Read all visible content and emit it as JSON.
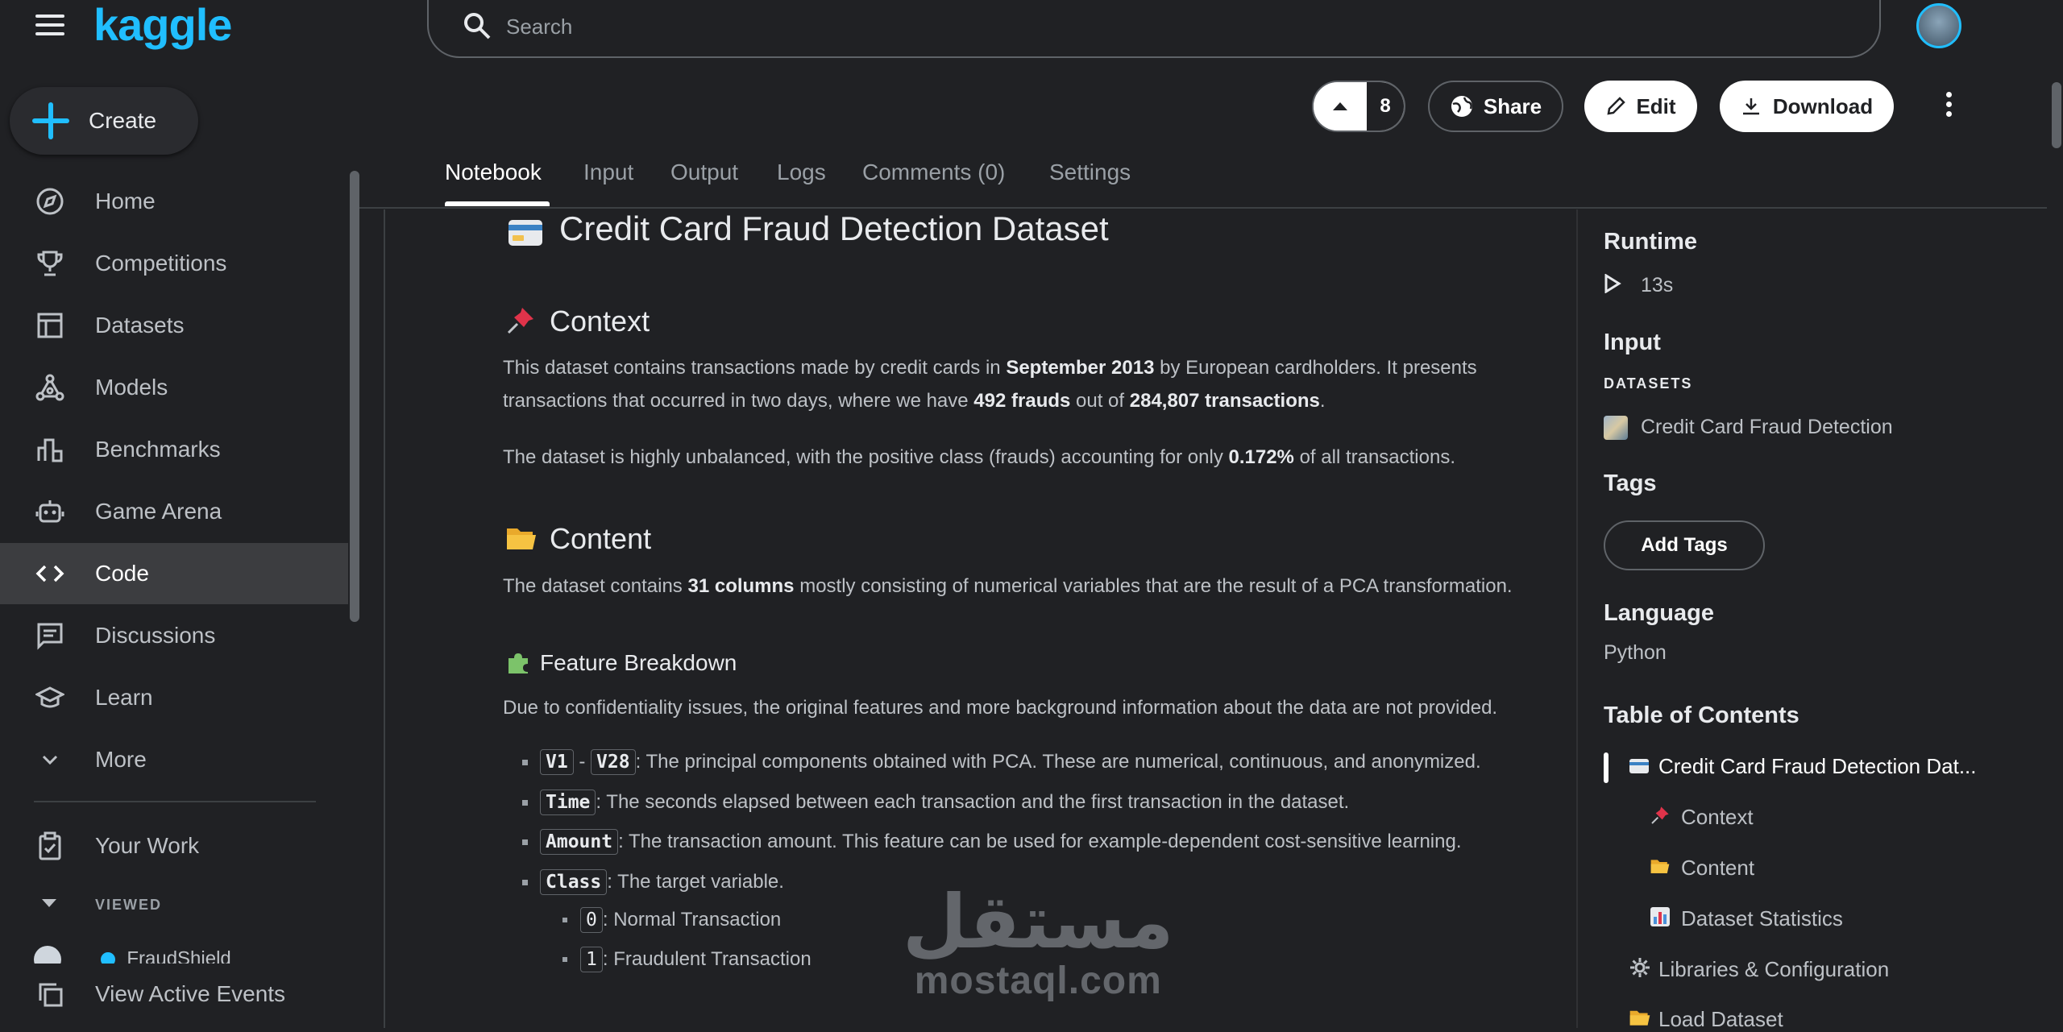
{
  "app": {
    "logo": "kaggle"
  },
  "search": {
    "placeholder": "Search"
  },
  "sidebar": {
    "create_label": "Create",
    "items": [
      {
        "label": "Home",
        "icon": "compass-icon"
      },
      {
        "label": "Competitions",
        "icon": "trophy-icon"
      },
      {
        "label": "Datasets",
        "icon": "table-icon"
      },
      {
        "label": "Models",
        "icon": "models-icon"
      },
      {
        "label": "Benchmarks",
        "icon": "bar-chart-icon"
      },
      {
        "label": "Game Arena",
        "icon": "robot-icon"
      },
      {
        "label": "Code",
        "icon": "code-icon",
        "active": true
      },
      {
        "label": "Discussions",
        "icon": "chat-icon"
      },
      {
        "label": "Learn",
        "icon": "school-icon"
      },
      {
        "label": "More",
        "icon": "chevron-down-icon"
      }
    ],
    "your_work": "Your Work",
    "viewed": "VIEWED",
    "viewed_item": "FraudShield",
    "active_events": "View Active Events"
  },
  "toolbar": {
    "vote_count": "8",
    "share": "Share",
    "edit": "Edit",
    "download": "Download"
  },
  "tabs": [
    "Notebook",
    "Input",
    "Output",
    "Logs",
    "Comments (0)",
    "Settings"
  ],
  "notebook": {
    "title": "Credit Card Fraud Detection Dataset",
    "context_heading": "Context",
    "context_p1_a": "This dataset contains transactions made by credit cards in ",
    "context_p1_b": "September 2013",
    "context_p1_c": " by European cardholders. It presents",
    "context_p1_d": "transactions that occurred in two days, where we have ",
    "context_p1_e": "492 frauds",
    "context_p1_f": " out of ",
    "context_p1_g": "284,807 transactions",
    "context_p1_h": ".",
    "context_p2_a": "The dataset is highly unbalanced, with the positive class (frauds) accounting for only ",
    "context_p2_b": "0.172%",
    "context_p2_c": " of all transactions.",
    "content_heading": "Content",
    "content_p_a": "The dataset contains ",
    "content_p_b": "31 columns",
    "content_p_c": " mostly consisting of numerical variables that are the result of a PCA transformation.",
    "feature_heading": "Feature Breakdown",
    "feature_p": "Due to confidentiality issues, the original features and more background information about the data are not provided.",
    "features": [
      {
        "code": "V1",
        "code2": "V28",
        "sep": " - ",
        "text": ": The principal components obtained with PCA. These are numerical, continuous, and anonymized."
      },
      {
        "code": "Time",
        "text": ": The seconds elapsed between each transaction and the first transaction in the dataset."
      },
      {
        "code": "Amount",
        "text": ": The transaction amount. This feature can be used for example-dependent cost-sensitive learning."
      },
      {
        "code": "Class",
        "text": ": The target variable."
      }
    ],
    "classes": [
      {
        "code": "0",
        "text": ": Normal Transaction"
      },
      {
        "code": "1",
        "text": ": Fraudulent Transaction"
      }
    ]
  },
  "right_panel": {
    "runtime_title": "Runtime",
    "runtime_value": "13s",
    "input_title": "Input",
    "datasets_caption": "DATASETS",
    "dataset_name": "Credit Card Fraud Detection",
    "tags_title": "Tags",
    "add_tags": "Add Tags",
    "language_title": "Language",
    "language_value": "Python",
    "toc_title": "Table of Contents",
    "toc": [
      "Credit Card Fraud Detection Dat...",
      "Context",
      "Content",
      "Dataset Statistics",
      "Libraries & Configuration",
      "Load Dataset"
    ]
  },
  "watermark": {
    "arabic": "مستقل",
    "latin": "mostaql.com"
  }
}
